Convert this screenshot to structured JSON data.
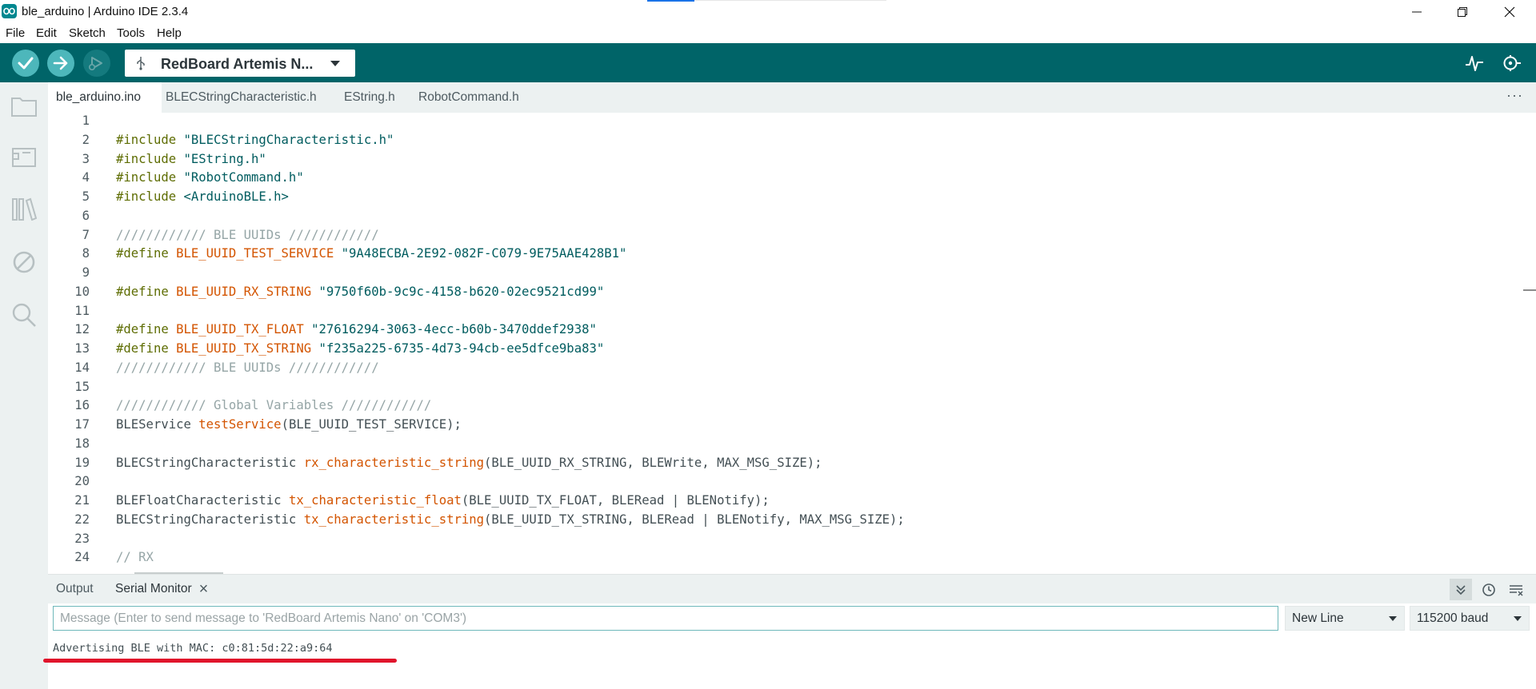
{
  "window": {
    "title": "ble_arduino | Arduino IDE 2.3.4"
  },
  "menu": [
    "File",
    "Edit",
    "Sketch",
    "Tools",
    "Help"
  ],
  "toolbar": {
    "board": "RedBoard Artemis N...",
    "accent_color": "#006468"
  },
  "tabs": [
    {
      "label": "ble_arduino.ino",
      "active": true
    },
    {
      "label": "BLECStringCharacteristic.h",
      "active": false
    },
    {
      "label": "EString.h",
      "active": false
    },
    {
      "label": "RobotCommand.h",
      "active": false
    }
  ],
  "tabs_more": "···",
  "code": [
    {
      "n": "1",
      "html": ""
    },
    {
      "n": "2",
      "html": "<span class='t-pre'>#include</span> <span class='t-str'>\"BLECStringCharacteristic.h\"</span>"
    },
    {
      "n": "3",
      "html": "<span class='t-pre'>#include</span> <span class='t-str'>\"EString.h\"</span>"
    },
    {
      "n": "4",
      "html": "<span class='t-pre'>#include</span> <span class='t-str'>\"RobotCommand.h\"</span>"
    },
    {
      "n": "5",
      "html": "<span class='t-pre'>#include</span> <span class='t-str'>&lt;ArduinoBLE.h&gt;</span>"
    },
    {
      "n": "6",
      "html": ""
    },
    {
      "n": "7",
      "html": "<span class='t-cmt'>//////////// BLE UUIDs ////////////</span>"
    },
    {
      "n": "8",
      "html": "<span class='t-pre'>#define</span> <span class='t-def'>BLE_UUID_TEST_SERVICE</span> <span class='t-str'>\"9A48ECBA-2E92-082F-C079-9E75AAE428B1\"</span>"
    },
    {
      "n": "9",
      "html": ""
    },
    {
      "n": "10",
      "html": "<span class='t-pre'>#define</span> <span class='t-def'>BLE_UUID_RX_STRING</span> <span class='t-str'>\"9750f60b-9c9c-4158-b620-02ec9521cd99\"</span>"
    },
    {
      "n": "11",
      "html": ""
    },
    {
      "n": "12",
      "html": "<span class='t-pre'>#define</span> <span class='t-def'>BLE_UUID_TX_FLOAT</span> <span class='t-str'>\"27616294-3063-4ecc-b60b-3470ddef2938\"</span>"
    },
    {
      "n": "13",
      "html": "<span class='t-pre'>#define</span> <span class='t-def'>BLE_UUID_TX_STRING</span> <span class='t-str'>\"f235a225-6735-4d73-94cb-ee5dfce9ba83\"</span>"
    },
    {
      "n": "14",
      "html": "<span class='t-cmt'>//////////// BLE UUIDs ////////////</span>"
    },
    {
      "n": "15",
      "html": ""
    },
    {
      "n": "16",
      "html": "<span class='t-cmt'>//////////// Global Variables ////////////</span>"
    },
    {
      "n": "17",
      "html": "BLEService <span class='t-fn'>testService</span>(BLE_UUID_TEST_SERVICE);"
    },
    {
      "n": "18",
      "html": ""
    },
    {
      "n": "19",
      "html": "BLECStringCharacteristic <span class='t-fn'>rx_characteristic_string</span>(BLE_UUID_RX_STRING, BLEWrite, MAX_MSG_SIZE);"
    },
    {
      "n": "20",
      "html": ""
    },
    {
      "n": "21",
      "html": "BLEFloatCharacteristic <span class='t-fn'>tx_characteristic_float</span>(BLE_UUID_TX_FLOAT, BLERead | BLENotify);"
    },
    {
      "n": "22",
      "html": "BLECStringCharacteristic <span class='t-fn'>tx_characteristic_string</span>(BLE_UUID_TX_STRING, BLERead | BLENotify, MAX_MSG_SIZE);"
    },
    {
      "n": "23",
      "html": ""
    },
    {
      "n": "24",
      "html": "<span class='t-cmt'>// RX</span>"
    }
  ],
  "bottom_panel": {
    "tabs": [
      "Output",
      "Serial Monitor"
    ],
    "close_glyph": "×",
    "message_placeholder": "Message (Enter to send message to 'RedBoard Artemis Nano' on 'COM3')",
    "line_ending": "New Line",
    "baud": "115200 baud",
    "output": "Advertising BLE with MAC: c0:81:5d:22:a9:64"
  }
}
